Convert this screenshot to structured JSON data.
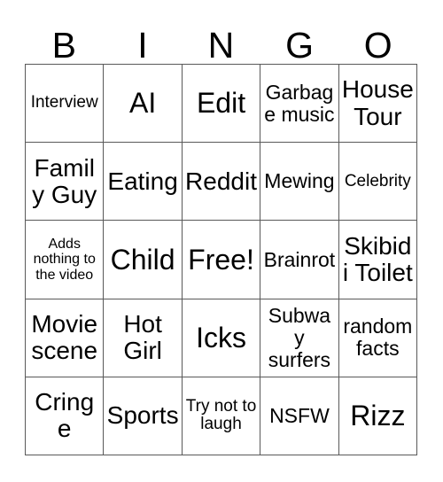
{
  "card": {
    "title": "BINGO Card",
    "header_letters": [
      "B",
      "I",
      "N",
      "G",
      "O"
    ],
    "columns": 5,
    "rows": 5,
    "background_color": "#ffffff",
    "border_color": "#595959",
    "text_color": "#000000",
    "free_space": "Free!",
    "cells": [
      [
        {
          "text": "Interview",
          "size": "sm"
        },
        {
          "text": "AI",
          "size": "xl"
        },
        {
          "text": "Edit",
          "size": "xl"
        },
        {
          "text": "Garbage music",
          "size": "md"
        },
        {
          "text": "House Tour",
          "size": "lg"
        }
      ],
      [
        {
          "text": "Family Guy",
          "size": "lg"
        },
        {
          "text": "Eating",
          "size": "lg"
        },
        {
          "text": "Reddit",
          "size": "lg"
        },
        {
          "text": "Mewing",
          "size": "md"
        },
        {
          "text": "Celebrity",
          "size": "sm"
        }
      ],
      [
        {
          "text": "Adds nothing to the video",
          "size": "xs"
        },
        {
          "text": "Child",
          "size": "xl"
        },
        {
          "text": "Free!",
          "size": "xl"
        },
        {
          "text": "Brainrot",
          "size": "md"
        },
        {
          "text": "Skibidi Toilet",
          "size": "lg"
        }
      ],
      [
        {
          "text": "Movie scene",
          "size": "lg"
        },
        {
          "text": "Hot Girl",
          "size": "lg"
        },
        {
          "text": "Icks",
          "size": "xl"
        },
        {
          "text": "Subway surfers",
          "size": "md"
        },
        {
          "text": "random facts",
          "size": "md"
        }
      ],
      [
        {
          "text": "Cringe",
          "size": "lg"
        },
        {
          "text": "Sports",
          "size": "lg"
        },
        {
          "text": "Try not to laugh",
          "size": "sm"
        },
        {
          "text": "NSFW",
          "size": "md"
        },
        {
          "text": "Rizz",
          "size": "xl"
        }
      ]
    ]
  }
}
